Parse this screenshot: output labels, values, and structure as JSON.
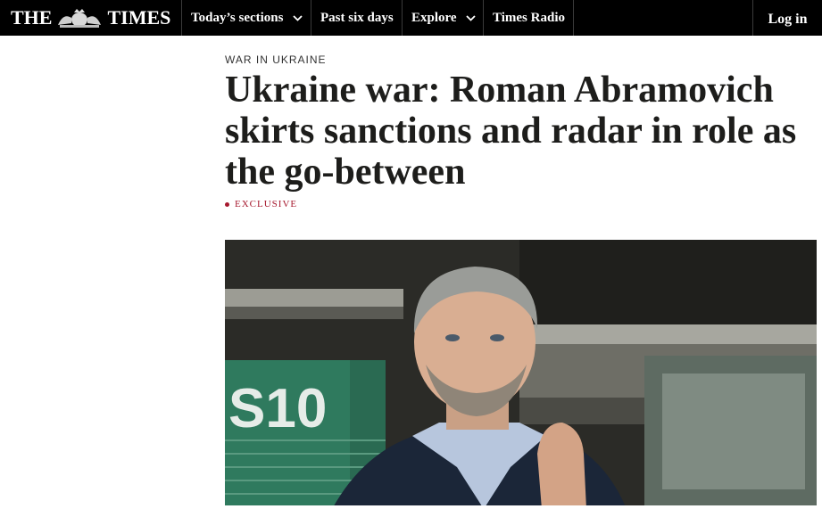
{
  "masthead": {
    "left": "THE",
    "right": "TIMES",
    "crest_icon": "royal-crest-icon"
  },
  "nav": {
    "items": [
      {
        "label": "Today’s sections",
        "icon": "chevron-down-icon"
      },
      {
        "label": "Past six days"
      },
      {
        "label": "Explore",
        "icon": "chevron-down-icon"
      },
      {
        "label": "Times Radio"
      }
    ],
    "login_label": "Log in"
  },
  "article": {
    "kicker": "WAR IN UKRAINE",
    "headline": "Ukraine war: Roman Abramovich skirts sanctions and radar in role as the go-between",
    "badge": "EXCLUSIVE",
    "hero_sign": "S10"
  },
  "colors": {
    "topbar": "#000000",
    "text": "#1d1d1b",
    "exclusive_red": "#a6192e"
  }
}
